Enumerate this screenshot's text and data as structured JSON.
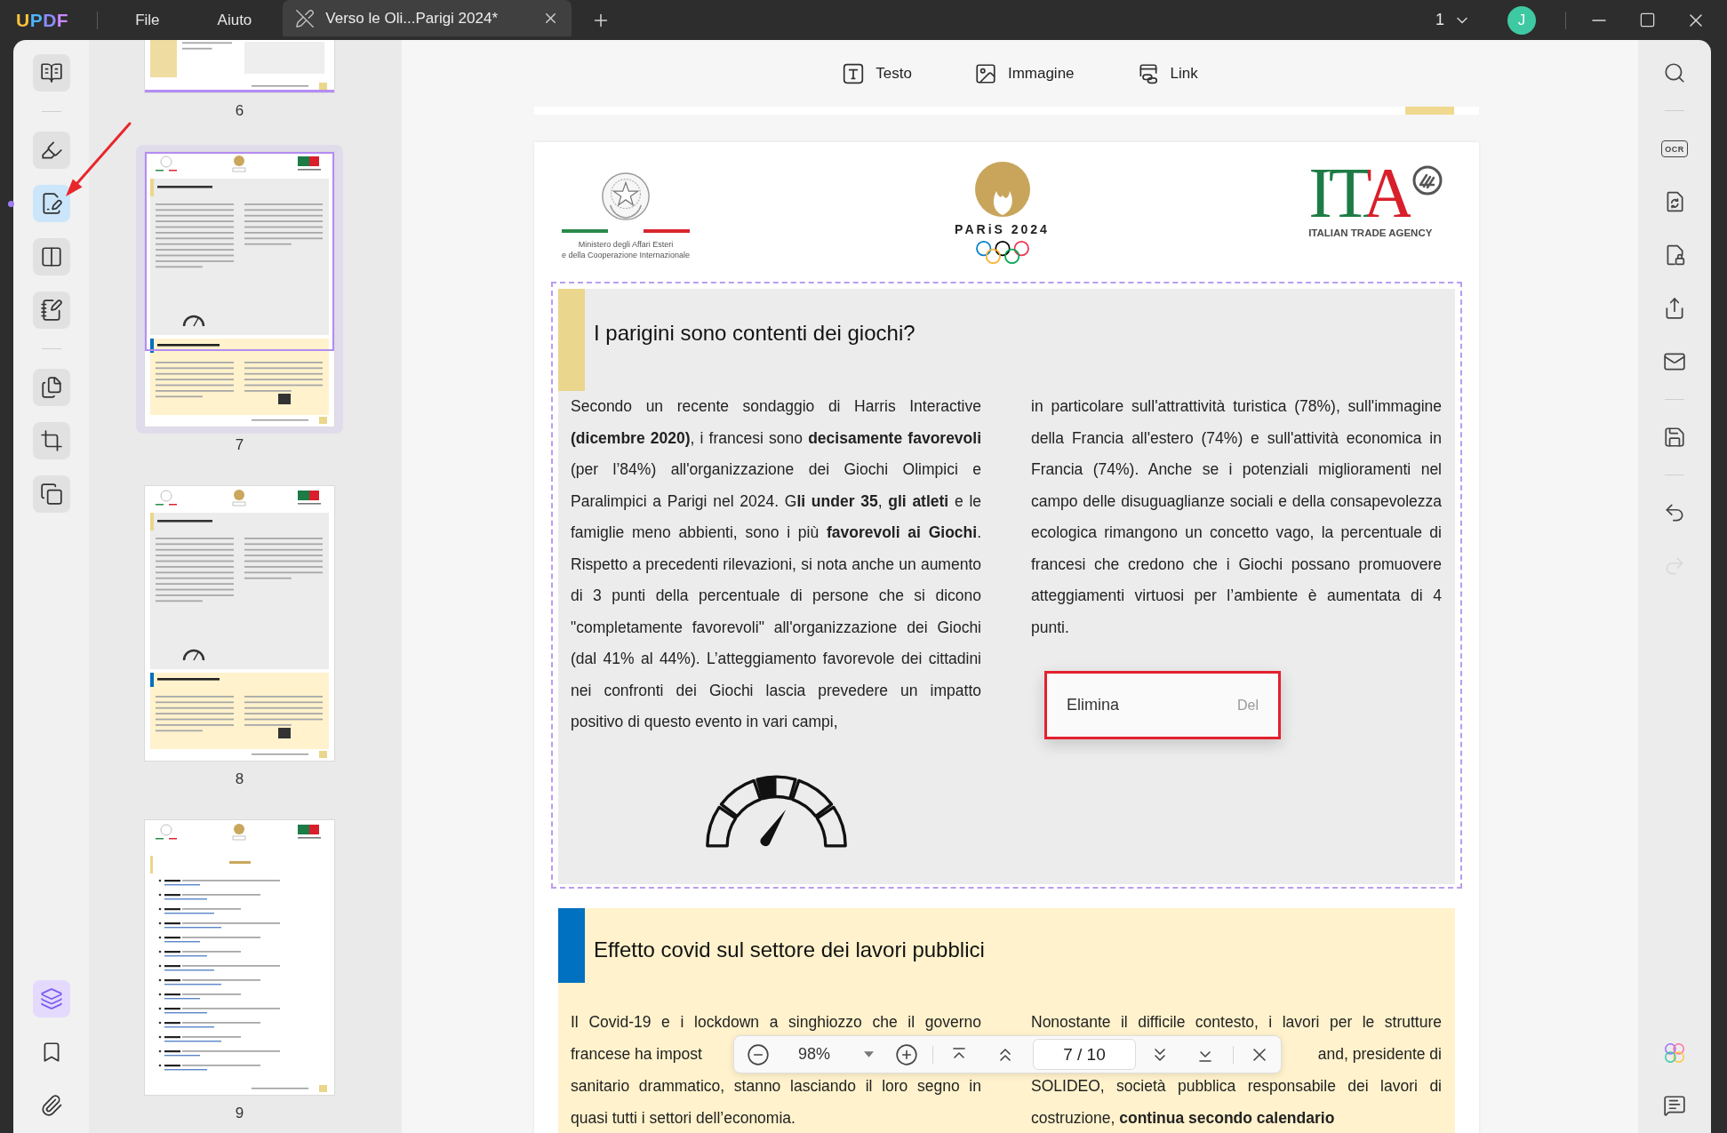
{
  "title_bar": {
    "app_name": "UPDF",
    "menu": [
      {
        "label": "File"
      },
      {
        "label": "Aiuto"
      }
    ],
    "tabs": [
      {
        "label": "Verso le Oli...Parigi 2024*",
        "selected": true
      }
    ],
    "window_count": "1",
    "avatar": "J"
  },
  "left_toolbar": {
    "groups": [
      {
        "tools": [
          {
            "kind": "reader",
            "selected": false
          }
        ]
      },
      {
        "tools": [
          {
            "kind": "comment",
            "selected": false
          },
          {
            "kind": "edit",
            "selected": true
          },
          {
            "kind": "organize",
            "selected": false
          },
          {
            "kind": "form",
            "selected": false
          }
        ]
      },
      {
        "tools": [
          {
            "kind": "pages",
            "selected": false
          },
          {
            "kind": "crop",
            "selected": false
          },
          {
            "kind": "overlay",
            "selected": false
          }
        ]
      }
    ],
    "bottom_tools": [
      {
        "kind": "layers",
        "selected": true
      },
      {
        "kind": "bookmark",
        "selected": false
      },
      {
        "kind": "attachment",
        "selected": false
      }
    ]
  },
  "thumbnails": [
    {
      "page": "6",
      "kind": "table",
      "selected": false
    },
    {
      "page": "7",
      "kind": "article",
      "selected": true
    },
    {
      "page": "8",
      "kind": "article",
      "selected": false
    },
    {
      "page": "9",
      "kind": "links",
      "selected": false
    }
  ],
  "edit_toolbar": {
    "tools": [
      {
        "kind": "text",
        "label": "Testo"
      },
      {
        "kind": "image",
        "label": "Immagine"
      },
      {
        "kind": "link",
        "label": "Link"
      }
    ]
  },
  "document": {
    "header": {
      "ministry": [
        "Ministero degli Affari Esteri",
        "e della Cooperazione Internazionale"
      ],
      "games_logo": "PARiS 2024",
      "agency_logo": "ITA",
      "agency_name": "ITALIAN TRADE AGENCY"
    },
    "sections": [
      {
        "kind": "paragraphs",
        "selected": true,
        "color": "#ead68c",
        "title": "I parigini sono contenti dei giochi?",
        "columns": [
          "Secondo un recente sondaggio di Harris Interactive **(dicembre 2020)**, i francesi sono **decisamente favorevoli** (per l’84%) all'organizzazione dei Giochi Olimpici e Paralimpici a Parigi nel 2024. G**li under 35**, **gli atleti** e le famiglie meno abbienti, sono i più **favorevoli ai Giochi**. Rispetto a precedenti rilevazioni, si nota anche un aumento di 3 punti della percentuale di persone che si dicono \"completamente favorevoli\" all'organizzazione dei Giochi (dal 41% al 44%). L’atteggiamento favorevole dei cittadini nei confronti dei Giochi lascia prevedere un impatto positivo di questo evento in vari campi,",
          "in particolare sull'attrattività turistica (78%), sull'immagine della Francia all'estero (74%) e sull'attività economica in Francia (74%). Anche se i potenziali miglioramenti nel campo delle disuguaglianze sociali e della consapevolezza ecologica rimangono un concetto vago, la percentuale di francesi che credono che i Giochi possano promuovere atteggiamenti virtuosi per l’ambiente è aumentata di 4 punti."
        ]
      },
      {
        "kind": "lines",
        "selected": false,
        "color": "#0070c0",
        "title": "Effetto covid sul settore dei lavori pubblici",
        "rows": [
          {
            "kind": "full",
            "left": "Il Covid-19 e i lockdown a singhiozzo che il governo",
            "right": "Nonostante il difficile contesto, i lavori per le strutture"
          },
          {
            "kind": "covered",
            "left": "francese ha impost",
            "right": "and, presidente di"
          },
          {
            "kind": "full",
            "left": "sanitario drammatico, stanno lasciando il loro segno in",
            "right": "SOLIDEO, società pubblica responsabile dei lavori di"
          },
          {
            "kind": "end",
            "left": "quasi tutti i settori dell’economia.",
            "right": "costruzione, **continua secondo calendario**"
          }
        ]
      }
    ]
  },
  "context_menu": {
    "items": [
      {
        "label": "Elimina",
        "shortcut": "Del"
      }
    ]
  },
  "zoom_bar": {
    "zoom": "98%",
    "page_field": {
      "value": "7 / 10"
    }
  },
  "right_toolbar": {
    "groups": [
      {
        "tools": [
          {
            "kind": "search",
            "disabled": false
          }
        ]
      },
      {
        "tools": [
          {
            "kind": "ocr",
            "label": "OCR",
            "disabled": false
          },
          {
            "kind": "convert",
            "disabled": false
          },
          {
            "kind": "protect",
            "disabled": false
          },
          {
            "kind": "share",
            "disabled": false
          },
          {
            "kind": "email",
            "disabled": false
          }
        ]
      },
      {
        "tools": [
          {
            "kind": "save",
            "disabled": false
          }
        ]
      },
      {
        "tools": [
          {
            "kind": "undo",
            "disabled": false
          },
          {
            "kind": "redo",
            "disabled": true
          }
        ]
      }
    ],
    "bottom_tools": [
      {
        "kind": "ai",
        "disabled": false
      },
      {
        "kind": "comments",
        "disabled": false
      }
    ]
  }
}
